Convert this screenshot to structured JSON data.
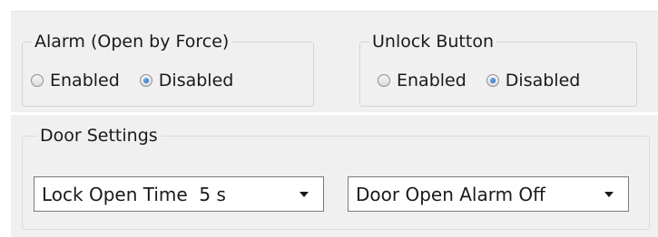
{
  "alarm_group": {
    "title": "Alarm (Open by Force)",
    "options": [
      {
        "label": "Enabled",
        "selected": false
      },
      {
        "label": "Disabled",
        "selected": true
      }
    ]
  },
  "unlock_group": {
    "title": "Unlock Button",
    "options": [
      {
        "label": "Enabled",
        "selected": false
      },
      {
        "label": "Disabled",
        "selected": true
      }
    ]
  },
  "door_settings": {
    "title": "Door Settings",
    "lock_open_time": "Lock Open Time  5 s",
    "door_open_alarm": "Door Open Alarm Off"
  },
  "icons": {
    "dropdown": "chevron-down-icon",
    "radio_selected_color": "#2a73c4"
  }
}
